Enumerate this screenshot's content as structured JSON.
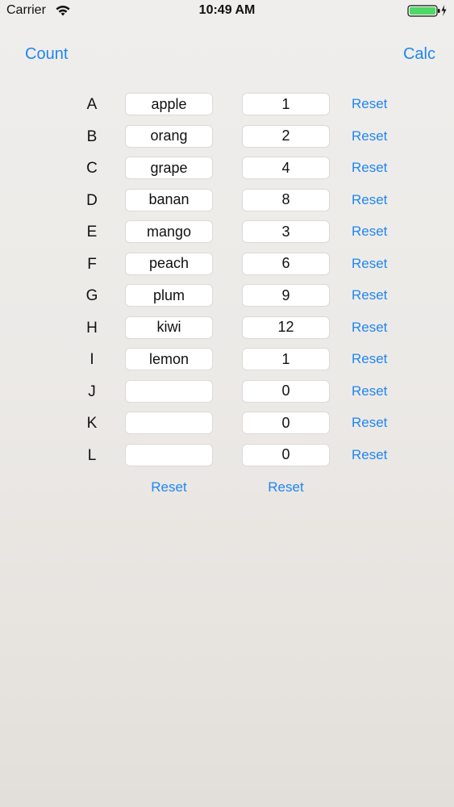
{
  "status_bar": {
    "carrier": "Carrier",
    "time": "10:49 AM",
    "wifi_icon": "wifi-icon",
    "battery_icon": "battery-charging-icon",
    "battery_color": "#4cd964"
  },
  "nav": {
    "left_label": "Count",
    "right_label": "Calc"
  },
  "accent_color": "#1f86f0",
  "rows": [
    {
      "label": "A",
      "name": "apple",
      "count": "1",
      "reset": "Reset"
    },
    {
      "label": "B",
      "name": "orang",
      "count": "2",
      "reset": "Reset"
    },
    {
      "label": "C",
      "name": "grape",
      "count": "4",
      "reset": "Reset"
    },
    {
      "label": "D",
      "name": "banan",
      "count": "8",
      "reset": "Reset"
    },
    {
      "label": "E",
      "name": "mango",
      "count": "3",
      "reset": "Reset"
    },
    {
      "label": "F",
      "name": "peach",
      "count": "6",
      "reset": "Reset"
    },
    {
      "label": "G",
      "name": "plum",
      "count": "9",
      "reset": "Reset"
    },
    {
      "label": "H",
      "name": "kiwi",
      "count": "12",
      "reset": "Reset"
    },
    {
      "label": "I",
      "name": "lemon",
      "count": "1",
      "reset": "Reset"
    },
    {
      "label": "J",
      "name": "",
      "count": "0",
      "reset": "Reset"
    },
    {
      "label": "K",
      "name": "",
      "count": "0",
      "reset": "Reset"
    },
    {
      "label": "L",
      "name": "",
      "count": "0",
      "reset": "Reset"
    }
  ],
  "column_resets": {
    "names": "Reset",
    "counts": "Reset"
  }
}
